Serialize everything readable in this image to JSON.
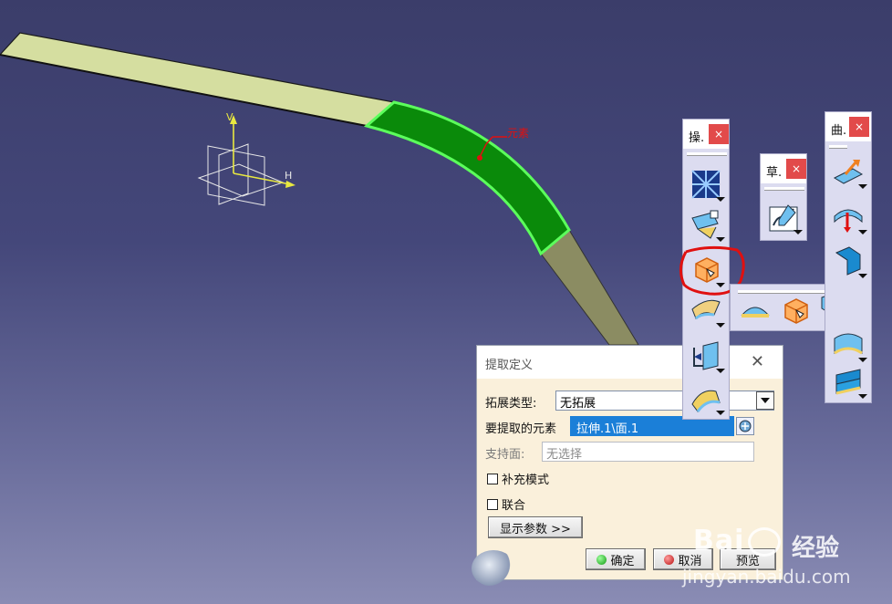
{
  "viewport": {
    "element_label": "元素",
    "axis_v_label": "V",
    "axis_h_label": "H"
  },
  "dialog": {
    "title": "提取定义",
    "extend_type_label": "拓展类型:",
    "extend_type_value": "无拓展",
    "element_label": "要提取的元素",
    "element_value": "拉伸.1\\面.1",
    "support_label": "支持面:",
    "support_value": "无选择",
    "complement_label": "补充模式",
    "federation_label": "联合",
    "show_params_label": "显示参数 >>",
    "ok_label": "确定",
    "cancel_label": "取消",
    "preview_label": "预览"
  },
  "toolbars": {
    "operations_title": "操.",
    "sketch_title": "草.",
    "surfaces_title": "曲.",
    "close_symbol": "×"
  },
  "watermark": {
    "logo": "Bai",
    "logo_cn": "经验",
    "url": "jingyan.baidu.com"
  },
  "colors": {
    "background_top": "#3b3d6a",
    "background_bottom": "#8a8cb4",
    "strip_fill": "#d5dea0",
    "selected_face": "#0a8a0a",
    "highlight_edge": "#5cff5c",
    "annotation_red": "#e01010",
    "toolbar_bg": "#dcdcf0",
    "dialog_bg": "#faf0db"
  }
}
